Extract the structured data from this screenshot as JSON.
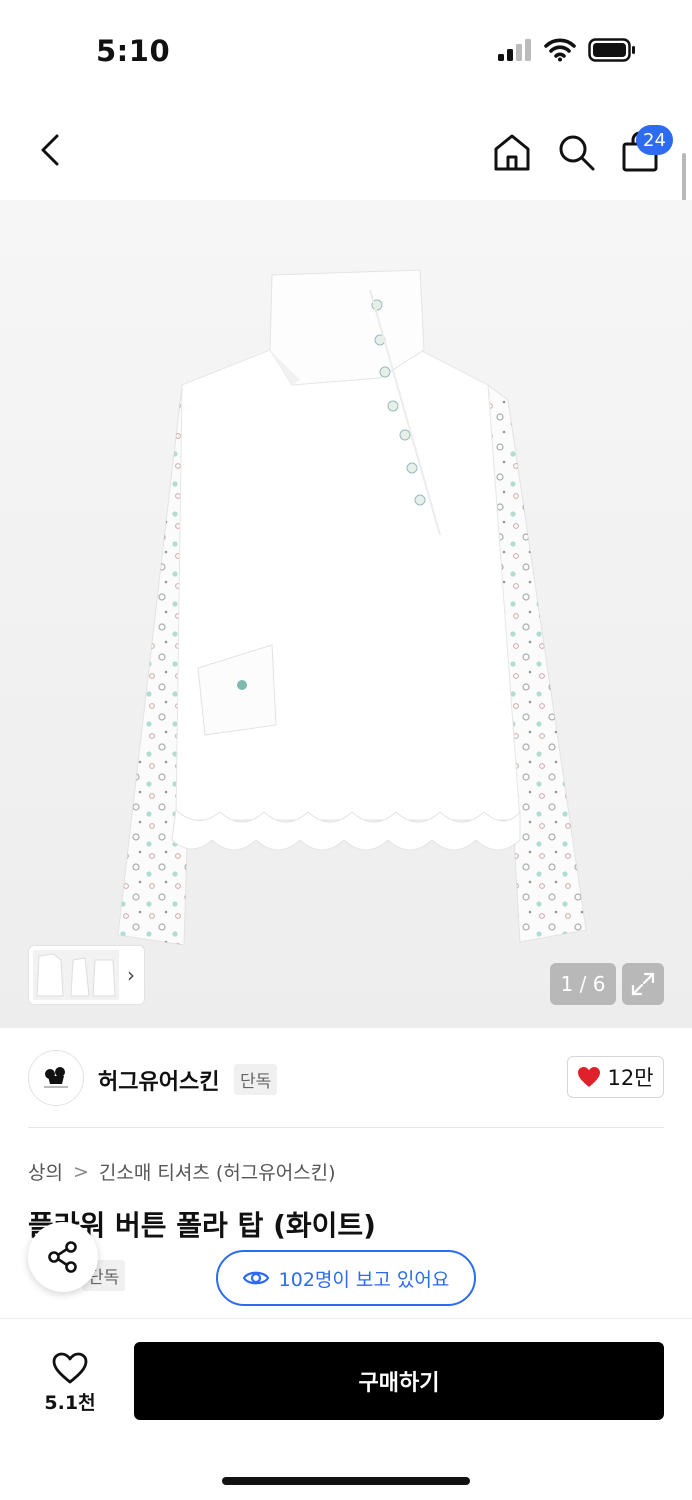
{
  "status_bar": {
    "time": "5:10"
  },
  "nav": {
    "cart_count": "24",
    "icons": [
      "back-icon",
      "home-icon",
      "search-icon",
      "bag-icon"
    ]
  },
  "gallery": {
    "counter": "1 / 6",
    "thumbnail_chevron": "›"
  },
  "brand": {
    "name": "허그유어스킨",
    "tag": "단독",
    "like_count": "12만",
    "like_color": "#e0202a"
  },
  "breadcrumb": {
    "items": [
      "상의",
      "긴소매 티셔츠 (허그유어스킨)"
    ],
    "separator": ">"
  },
  "product": {
    "title": "플라워 버튼 폴라 탑 (화이트)",
    "exclusive_tag": "단독"
  },
  "viewers": {
    "text": "102명이 보고 있어요",
    "accent": "#2d6bf0"
  },
  "bottom_bar": {
    "wish_count": "5.1천",
    "buy_label": "구매하기"
  }
}
